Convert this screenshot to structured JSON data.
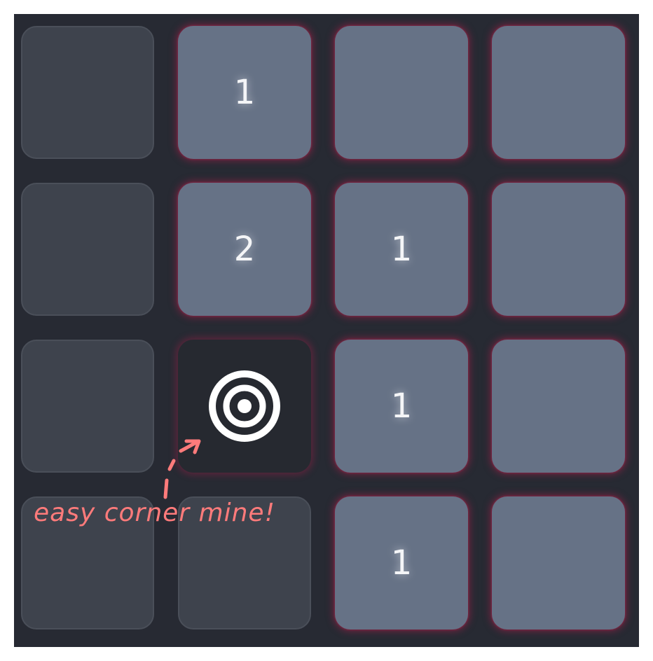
{
  "board": {
    "rows": 4,
    "cols": 4,
    "cells": [
      [
        {
          "state": "revealed",
          "label": ""
        },
        {
          "state": "unrevealed",
          "label": "1"
        },
        {
          "state": "unrevealed",
          "label": ""
        },
        {
          "state": "unrevealed",
          "label": ""
        }
      ],
      [
        {
          "state": "revealed",
          "label": ""
        },
        {
          "state": "unrevealed",
          "label": "2"
        },
        {
          "state": "unrevealed",
          "label": "1"
        },
        {
          "state": "unrevealed",
          "label": ""
        }
      ],
      [
        {
          "state": "revealed",
          "label": ""
        },
        {
          "state": "mine",
          "label": ""
        },
        {
          "state": "unrevealed",
          "label": "1"
        },
        {
          "state": "unrevealed",
          "label": ""
        }
      ],
      [
        {
          "state": "revealed",
          "label": ""
        },
        {
          "state": "revealed",
          "label": ""
        },
        {
          "state": "unrevealed",
          "label": "1"
        },
        {
          "state": "unrevealed",
          "label": ""
        }
      ]
    ]
  },
  "annotation": {
    "text": "easy corner mine!",
    "color": "#ff7b7b"
  },
  "icons": {
    "mine": "target-icon",
    "annotation_arrow": "dashed-arrow-icon"
  },
  "colors": {
    "board_background": "#272a33",
    "unrevealed_tile": "#667286",
    "revealed_tile": "#3e434d",
    "mine_tile": "#262930",
    "glow": "#a02048"
  }
}
